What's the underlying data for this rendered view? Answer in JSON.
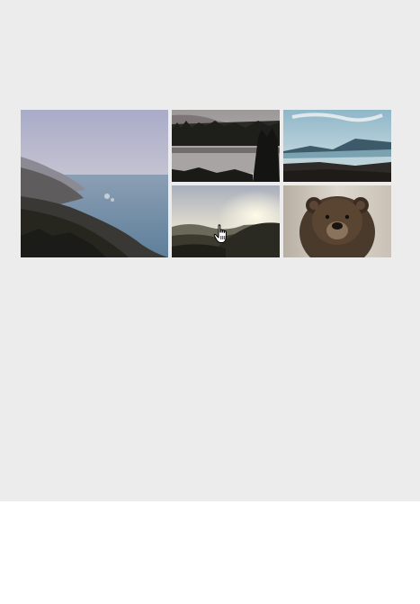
{
  "gallery": {
    "photos": [
      {
        "subject": "coastal-cliffs-photo"
      },
      {
        "subject": "forest-lake-photo"
      },
      {
        "subject": "mountain-lake-photo"
      },
      {
        "subject": "sunset-hills-photo"
      },
      {
        "subject": "bear-photo"
      }
    ]
  },
  "cursor": {
    "icon": "hand-pointer-icon"
  },
  "colors": {
    "stage_background": "#ececec",
    "page_background": "#ffffff"
  }
}
